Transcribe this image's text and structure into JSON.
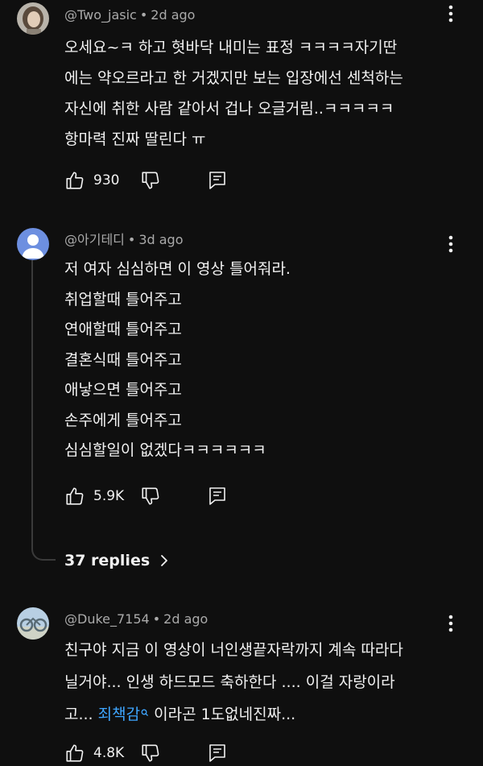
{
  "comments": [
    {
      "author": "@Two_jasic",
      "time": "2d ago",
      "lines": [
        "오세요~ㅋ 하고 혓바닥 내미는 표정 ㅋㅋㅋㅋ자기딴",
        "에는 약오르라고 한 거겠지만 보는 입장에선 센척하는",
        "자신에 취한 사람 같아서 겁나 오글거림..ㅋㅋㅋㅋㅋ",
        "항마력 진짜 딸린다 ㅠ"
      ],
      "likes": "930"
    },
    {
      "author": "@아기테디",
      "time": "3d ago",
      "lines": [
        "저 여자 심심하면 이 영상 틀어줘라.",
        "취업할때 틀어주고",
        "연애할때 틀어주고",
        "결혼식때 틀어주고",
        "애낳으면 틀어주고",
        "손주에게 틀어주고",
        "심심할일이 없겠다ㅋㅋㅋㅋㅋㅋ"
      ],
      "likes": "5.9K",
      "replies_label": "37 replies"
    },
    {
      "author": "@Duke_7154",
      "time": "2d ago",
      "lines": [
        "친구야 지금 이 영상이 너인생끝자락까지 계속 따라다",
        "닐거야... 인생 하드모드 축하한다 .... 이걸 자랑이라"
      ],
      "line3_prefix": "고... ",
      "line3_link": "죄책감",
      "line3_suffix": " 이라곤 1도없네진짜...",
      "likes": "4.8K"
    }
  ],
  "separator": "•",
  "icons": {
    "like": "thumbs-up-icon",
    "dislike": "thumbs-down-icon",
    "reply": "reply-icon",
    "more": "more-vertical-icon",
    "chevron": "chevron-right-icon",
    "search": "search-icon"
  },
  "colors": {
    "background": "#0f0f0f",
    "text": "#f1f1f1",
    "meta": "#aaaaaa",
    "link": "#3ea6ff",
    "default_avatar": "#6d8fe0"
  }
}
